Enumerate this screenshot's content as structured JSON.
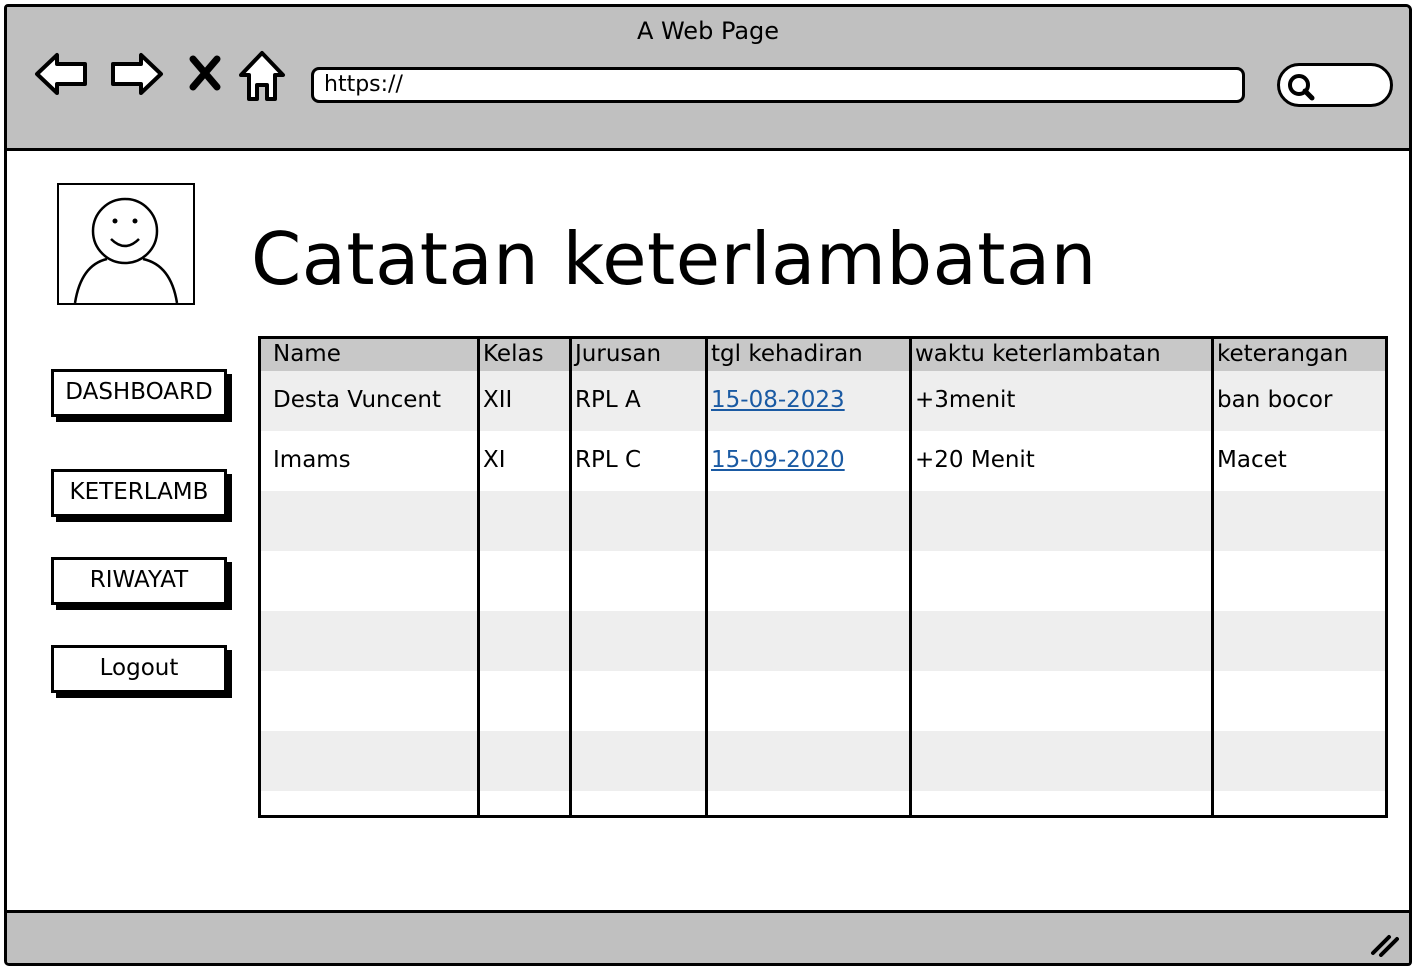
{
  "window": {
    "title": "A Web Page",
    "url": "https://"
  },
  "icons": {
    "back": "back-arrow-icon",
    "forward": "forward-arrow-icon",
    "stop": "close-icon",
    "home": "home-icon",
    "search": "search-icon",
    "avatar": "user-avatar-icon",
    "resize": "resize-grip-icon"
  },
  "page": {
    "title": "Catatan keterlambatan"
  },
  "sidebar": {
    "items": [
      {
        "label": "DASHBOARD"
      },
      {
        "label": "KETERLAMB"
      },
      {
        "label": "RIWAYAT"
      },
      {
        "label": "Logout"
      }
    ]
  },
  "table": {
    "headers": [
      "Name",
      "Kelas",
      "Jurusan",
      "tgl kehadiran",
      "waktu keterlambatan",
      "keterangan"
    ],
    "rows": [
      [
        "Desta Vuncent",
        "XII",
        "RPL A",
        "15-08-2023",
        "+3menit",
        "ban bocor"
      ],
      [
        "Imams",
        "XI",
        "RPL C",
        "15-09-2020",
        "+20 Menit",
        "Macet"
      ]
    ]
  },
  "colors": {
    "chrome": "#c0c0c0",
    "header": "#c8c8c8",
    "stripe": "#eeeeee",
    "link": "#1a5aa3"
  }
}
